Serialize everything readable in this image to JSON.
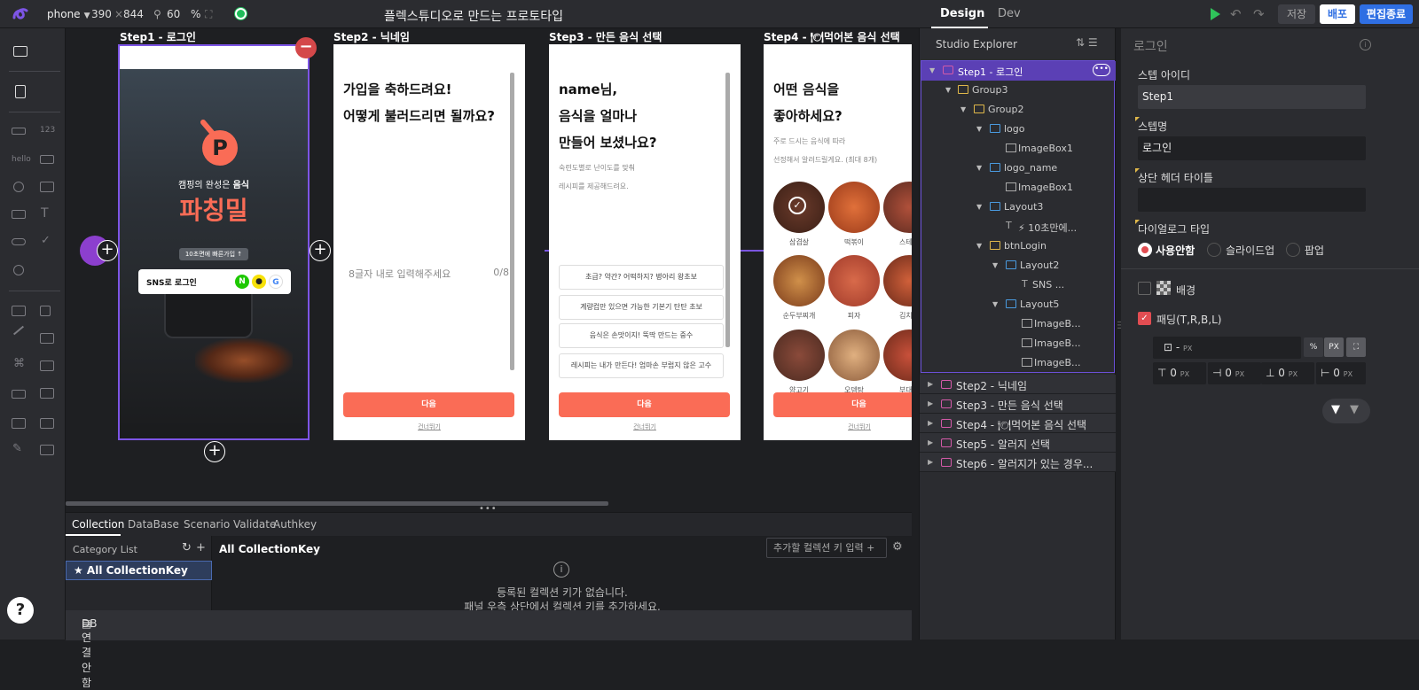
{
  "topbar": {
    "device": "phone",
    "width": "390",
    "height_sep": "×",
    "height": "844",
    "zoom": "60",
    "zoom_unit": "%",
    "title": "플렉스튜디오로 만드는 프로토타입",
    "tab_design": "Design",
    "tab_dev": "Dev",
    "save": "저장",
    "deploy": "배포",
    "end_edit": "편집종료"
  },
  "canvas": {
    "steps": [
      {
        "title": "Step1 - 로그인"
      },
      {
        "title": "Step2 - 닉네임"
      },
      {
        "title": "Step3 - 만든 음식 선택"
      },
      {
        "title": "Step4 - 🍽먹어본 음식 선택"
      }
    ],
    "step1": {
      "subtitle_a": "캠핑의 완성은 ",
      "subtitle_b": "음식",
      "brand": "파칭밀",
      "pill": "10초면에 빠른가입 ↑",
      "sns_label": "SNS로 로그인",
      "sns_n": "N",
      "sns_k": "●",
      "sns_g": "G"
    },
    "step2": {
      "line1": "가입을 축하드려요!",
      "line2": "어떻게 불러드리면 될까요?",
      "placeholder": "8글자 내로 입력해주세요",
      "counter": "0/8",
      "next": "다음",
      "skip": "건너뛰기"
    },
    "step3": {
      "line1": "name님,",
      "line2": "음식을 얼마나",
      "line3": "만들어 보셨나요?",
      "desc1": "숙련도별로 난이도를 맞춰",
      "desc2": "레시피를 제공해드려요.",
      "options": [
        "초급? 약간? 어떡하지? 병아리 왕초보",
        "계량컵만 있으면 가능한 기본기 탄탄 초보",
        "음식은 손맛이지! 뚝딱 만드는 중수",
        "레시피는 내가 만든다! 엄마손 부럽지 않은 고수"
      ],
      "next": "다음",
      "skip": "건너뛰기"
    },
    "step4": {
      "line1": "어떤 음식을",
      "line2": "좋아하세요?",
      "desc1": "주로 드시는 음식에 따라",
      "desc2": "선정해서 알려드릴게요. (최대 8개)",
      "foods": [
        "삼겹살",
        "떡볶이",
        "스테이",
        "순두부찌개",
        "피자",
        "김치찌",
        "양고기",
        "오뎅탕",
        "부대찌"
      ],
      "check": "✓",
      "next": "다음",
      "skip": "건너뛰기"
    },
    "minus": "−",
    "plus": "+"
  },
  "bottom": {
    "tabs": [
      "Collection",
      "DataBase",
      "Scenario Validate",
      "Authkey"
    ],
    "category_list": "Category List",
    "refresh": "↻",
    "add": "+",
    "all_collection_key_item": "★ All CollectionKey",
    "all_collection_key": "All CollectionKey",
    "add_key_placeholder": "추가할 컬렉션 키 입력 +",
    "gear": "⚙",
    "info": "i",
    "empty_line1": "등록된 컬렉션 키가 없습니다.",
    "empty_line2": "패널 우측 상단에서 컬렉션 키를 추가하세요.",
    "db_status": "DB 연결안함"
  },
  "explorer": {
    "title": "Studio Explorer",
    "tree": [
      {
        "label": "Step1 - 로그인"
      },
      {
        "label": "Group3"
      },
      {
        "label": "Group2"
      },
      {
        "label": "logo"
      },
      {
        "label": "ImageBox1"
      },
      {
        "label": "logo_name"
      },
      {
        "label": "ImageBox1"
      },
      {
        "label": "Layout3"
      },
      {
        "label": "⚡ 10초만에..."
      },
      {
        "label": "btnLogin"
      },
      {
        "label": "Layout2"
      },
      {
        "label": "SNS ..."
      },
      {
        "label": "Layout5"
      },
      {
        "label": "ImageB..."
      },
      {
        "label": "ImageB..."
      },
      {
        "label": "ImageB..."
      }
    ],
    "steps": [
      {
        "label": "Step2 - 닉네임"
      },
      {
        "label": "Step3 - 만든 음식 선택"
      },
      {
        "label": "Step4 - 🍽먹어본 음식 선택"
      },
      {
        "label": "Step5 - 알러지 선택"
      },
      {
        "label": "Step6 - 알러지가 있는 경우..."
      }
    ],
    "dots": "•••"
  },
  "props": {
    "title": "로그인",
    "step_id_label": "스텝 아이디",
    "step_id_value": "Step1",
    "step_name_label": "스텝명",
    "step_name_value": "로그인",
    "header_title_label": "상단 헤더 타이틀",
    "header_title_value": "",
    "dialog_type_label": "다이얼로그 타입",
    "dialog_options": [
      "사용안함",
      "슬라이드업",
      "팝업"
    ],
    "background_label": "배경",
    "padding_label": "패딩(T,R,B,L)",
    "padding_check": "✓",
    "padding_all": "-",
    "unit_px_small": "PX",
    "unit_pct": "%",
    "unit_px": "PX",
    "pad_values": [
      "0",
      "0",
      "0",
      "0"
    ]
  }
}
